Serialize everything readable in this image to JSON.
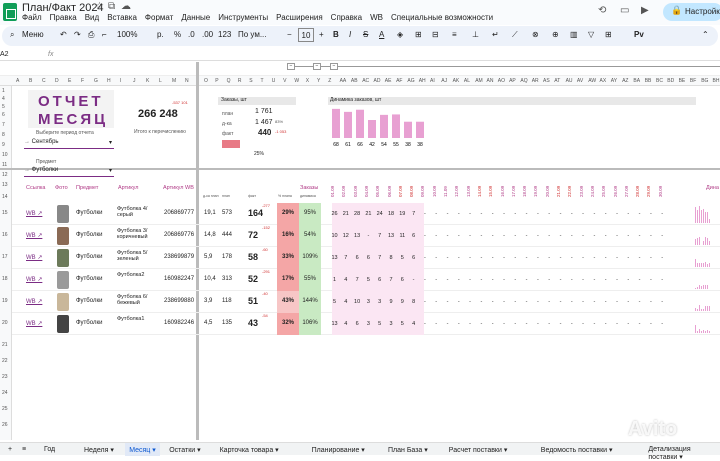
{
  "app": {
    "title": "План/Факт 2024",
    "share_label": "Настройки"
  },
  "menu": [
    "Файл",
    "Правка",
    "Вид",
    "Вставка",
    "Формат",
    "Данные",
    "Инструменты",
    "Расширения",
    "Справка",
    "WB",
    "Специальные возможности"
  ],
  "toolbar": {
    "search": "Меню",
    "zoom": "100%",
    "currency": "р.",
    "percent": "%",
    "dec1": ".0",
    "dec2": ".00",
    "fmt123": "123",
    "font": "По ум...",
    "size": "10",
    "pv": "Pv"
  },
  "formula_bar": {
    "cell": "A2",
    "fx": "fx"
  },
  "columns_left": [
    "A",
    "B",
    "C",
    "D",
    "E",
    "F",
    "G",
    "H",
    "I",
    "J",
    "K",
    "L",
    "M",
    "N"
  ],
  "columns_right": [
    "O",
    "P",
    "Q",
    "R",
    "S",
    "T",
    "U",
    "V",
    "W",
    "X",
    "Y",
    "Z",
    "AA",
    "AB",
    "AC",
    "AD",
    "AE",
    "AF",
    "AG",
    "AH",
    "AI",
    "AJ",
    "AK",
    "AL",
    "AM",
    "AN",
    "AO",
    "AP",
    "AQ",
    "AR",
    "AS",
    "AT",
    "AU",
    "AV",
    "AW",
    "AX",
    "AY",
    "AZ",
    "BA",
    "BB",
    "BC",
    "BD",
    "BE",
    "BF",
    "BG",
    "BH"
  ],
  "row_numbers": [
    "1",
    "4",
    "5",
    "6",
    "7",
    "8",
    "9",
    "10",
    "11",
    "12",
    "13",
    "14",
    "15",
    "16",
    "17",
    "18",
    "19",
    "20",
    "21",
    "22",
    "23",
    "24",
    "25",
    "26"
  ],
  "report": {
    "title_line1": "ОТЧЕТ",
    "title_line2": "МЕСЯЦ",
    "period_label": "Выберите период отчета",
    "period_value": "Сентябрь",
    "subject_label": "Предмет",
    "subject_value": "Футболки",
    "total_delta": "-537 101",
    "total_value": "266 248",
    "total_label": "Итого к перечислению"
  },
  "orders_summary": {
    "header": "Заказы, шт",
    "plan_label": "план",
    "plan_value": "1 761",
    "dka_label": "д-ка",
    "dka_value": "1 467",
    "dka_pct": "83%",
    "fact_label": "факт",
    "fact_value": "440",
    "fact_delta": "-1 053",
    "percent": "25%"
  },
  "dynamics": {
    "header": "Динамика заказов, шт",
    "values": [
      68,
      61,
      66,
      42,
      54,
      55,
      38,
      38
    ],
    "labels": [
      "68",
      "61",
      "66",
      "42",
      "54",
      "55",
      "38",
      "38"
    ]
  },
  "table_header": {
    "link": "Ссылка",
    "photo": "Фото",
    "subject": "Предмет",
    "article": "Артикул",
    "article_wb": "Артикул WB",
    "orders": "Заказы",
    "dynamics_tail": "Дина",
    "sub": [
      "д-ка план",
      "план",
      "факт",
      "% плана",
      "динамика"
    ]
  },
  "dates": [
    "01.09",
    "02.09",
    "03.09",
    "04.09",
    "05.09",
    "06.09",
    "07.09",
    "08.09",
    "09.09",
    "10.09",
    "11.09",
    "12.09",
    "13.09",
    "14.09",
    "15.09",
    "16.09",
    "17.09",
    "18.09",
    "19.09",
    "20.09",
    "21.09",
    "22.09",
    "23.09",
    "24.09",
    "25.09",
    "26.09",
    "27.09",
    "28.09",
    "29.09",
    "30.09"
  ],
  "rows": [
    {
      "num": "15",
      "link": "WB ↗",
      "subject": "Футболки",
      "article": "Футболка 4/серый",
      "wb": "206869777",
      "dka": "19,1",
      "plan": "573",
      "fact": "164",
      "delta": "-277",
      "pct": "29%",
      "pct_color": "#f4a6a6",
      "din": "95%",
      "days": [
        "26",
        "21",
        "28",
        "21",
        "24",
        "18",
        "19",
        "7"
      ]
    },
    {
      "num": "16",
      "link": "WB ↗",
      "subject": "Футболки",
      "article": "Футболка 3/коричневый",
      "wb": "206869776",
      "dka": "14,8",
      "plan": "444",
      "fact": "72",
      "delta": "-152",
      "pct": "16%",
      "pct_color": "#f4a6a6",
      "din": "54%",
      "days": [
        "10",
        "12",
        "13",
        "-",
        "7",
        "13",
        "11",
        "6"
      ]
    },
    {
      "num": "17",
      "link": "WB ↗",
      "subject": "Футболки",
      "article": "Футболка 5/зеленый",
      "wb": "238699879",
      "dka": "5,9",
      "plan": "178",
      "fact": "58",
      "delta": "-60",
      "pct": "33%",
      "pct_color": "#f4a6a6",
      "din": "109%",
      "days": [
        "13",
        "7",
        "6",
        "6",
        "7",
        "8",
        "5",
        "6"
      ]
    },
    {
      "num": "18",
      "link": "WB ↗",
      "subject": "Футболки",
      "article": "Футболка2",
      "wb": "160982247",
      "dka": "10,4",
      "plan": "313",
      "fact": "52",
      "delta": "-291",
      "pct": "17%",
      "pct_color": "#f4a6a6",
      "din": "55%",
      "days": [
        "1",
        "4",
        "7",
        "5",
        "6",
        "7",
        "6",
        "-"
      ]
    },
    {
      "num": "19",
      "link": "WB ↗",
      "subject": "Футболки",
      "article": "Футболка 6/бежевый",
      "wb": "238699880",
      "dka": "3,9",
      "plan": "118",
      "fact": "51",
      "delta": "-40",
      "pct": "43%",
      "pct_color": "#f7c6c6",
      "din": "144%",
      "days": [
        "5",
        "4",
        "10",
        "3",
        "3",
        "9",
        "9",
        "8"
      ]
    },
    {
      "num": "20",
      "link": "WB ↗",
      "subject": "Футболки",
      "article": "Футболка1",
      "wb": "160982246",
      "dka": "4,5",
      "plan": "135",
      "fact": "43",
      "delta": "-54",
      "pct": "32%",
      "pct_color": "#f4a6a6",
      "din": "106%",
      "days": [
        "13",
        "4",
        "6",
        "3",
        "5",
        "3",
        "5",
        "4"
      ]
    }
  ],
  "tabs": [
    "Год",
    "Неделя",
    "Месяц",
    "Остатки",
    "Карточка товара",
    "Планирование",
    "План База",
    "Расчет поставки",
    "Ведомость поставки",
    "Детализация поставки"
  ],
  "active_tab": "Месяц",
  "watermark": "Avito"
}
